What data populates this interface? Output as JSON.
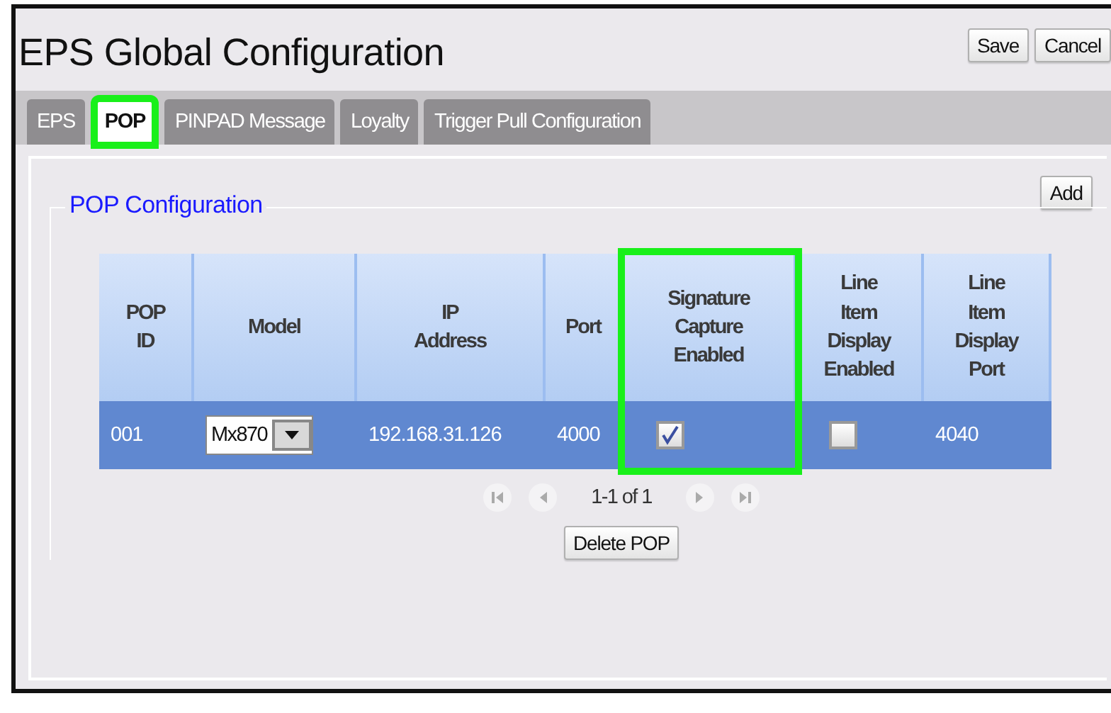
{
  "title": "EPS Global Configuration",
  "header_buttons": [
    "Save",
    "Cancel"
  ],
  "tabs": [
    {
      "label": "EPS",
      "selected": false,
      "highlighted": false
    },
    {
      "label": "POP",
      "selected": true,
      "highlighted": true
    },
    {
      "label": "PINPAD Message",
      "selected": false,
      "highlighted": false
    },
    {
      "label": "Loyalty",
      "selected": false,
      "highlighted": false
    },
    {
      "label": "Trigger Pull Configuration",
      "selected": false,
      "highlighted": false
    }
  ],
  "add_button": "Add",
  "section_title": "POP Configuration",
  "table": {
    "columns": [
      {
        "label": "POP ID",
        "highlighted": false
      },
      {
        "label": "Model",
        "highlighted": false
      },
      {
        "label": "IP Address",
        "highlighted": false
      },
      {
        "label": "Port",
        "highlighted": false
      },
      {
        "label": "Signature Capture Enabled",
        "highlighted": true
      },
      {
        "label": "Line Item Display Enabled",
        "highlighted": false
      },
      {
        "label": "Line Item Display Port",
        "highlighted": false
      }
    ],
    "rows": [
      {
        "selected": true,
        "cells": [
          {
            "kind": "text",
            "text": "001"
          },
          {
            "kind": "select",
            "value": "Mx870"
          },
          {
            "kind": "text",
            "text": "192.168.31.126"
          },
          {
            "kind": "text",
            "text": "4000"
          },
          {
            "kind": "checkbox",
            "checked": true
          },
          {
            "kind": "checkbox",
            "checked": false
          },
          {
            "kind": "text",
            "text": "4040"
          }
        ]
      }
    ]
  },
  "pagination": {
    "text": "1-1 of 1"
  },
  "delete_button": "Delete POP"
}
